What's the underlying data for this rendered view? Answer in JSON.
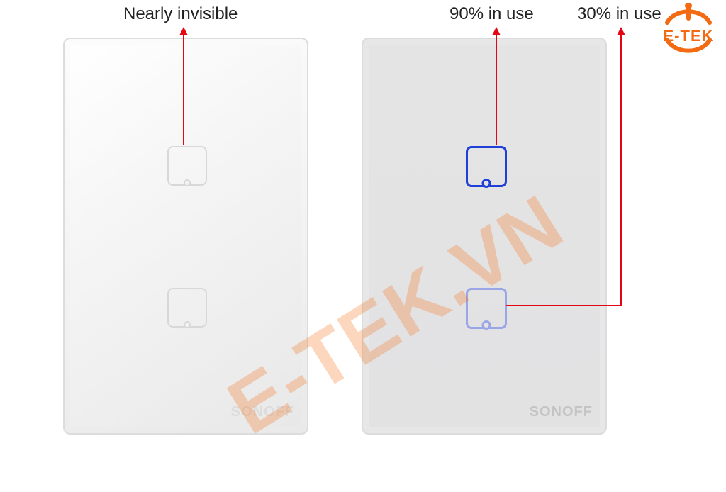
{
  "labels": {
    "left": "Nearly invisible",
    "mid": "90% in use",
    "right": "30% in use"
  },
  "brand": "SONOFF",
  "watermark": "E-TEK.VN",
  "logo_text": "E-TEK",
  "colors": {
    "arrow": "#e30613",
    "blue_strong": "#1f3fd6",
    "blue_weak": "#9aa6e6",
    "orange": "#f26a12"
  },
  "panels": {
    "left": {
      "state": "off",
      "buttons": 2
    },
    "right": {
      "state": "on",
      "buttons": 2,
      "brightness": [
        "90%",
        "30%"
      ]
    }
  }
}
